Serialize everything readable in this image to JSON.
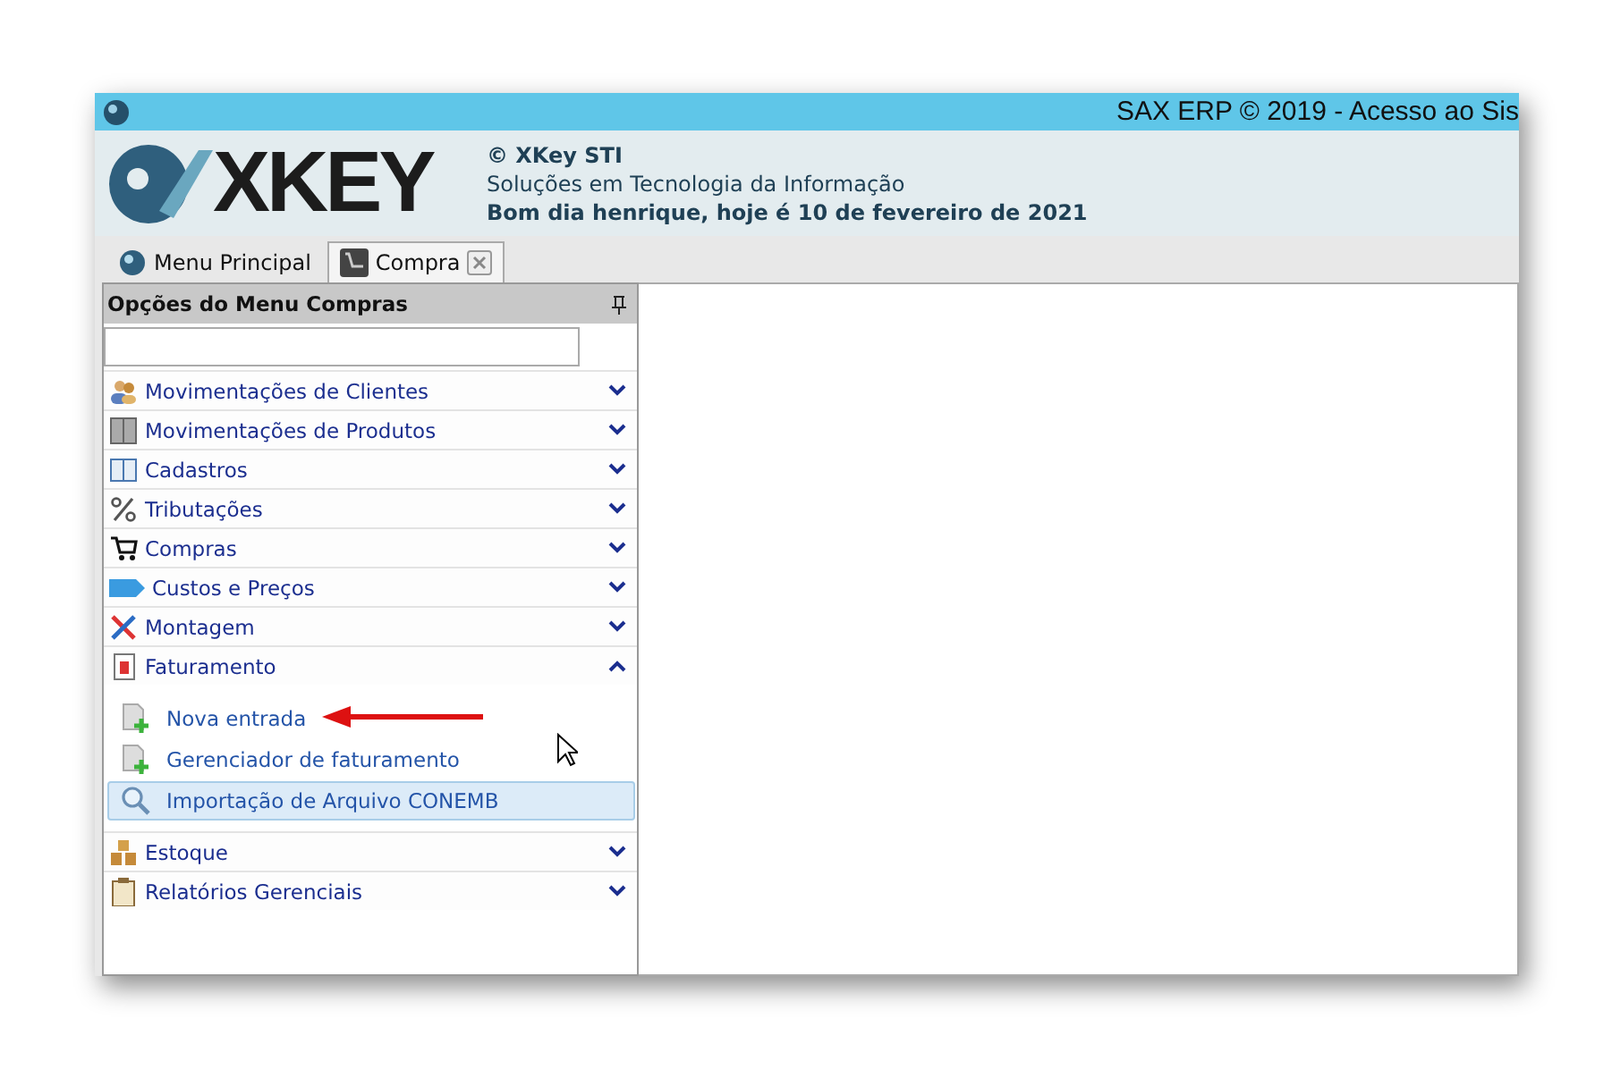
{
  "window": {
    "title": "SAX ERP © 2019 - Acesso ao Sis"
  },
  "header": {
    "logo_text": "XKEY",
    "company": "© XKey STI",
    "tagline": "Soluções em Tecnologia da Informação",
    "greeting": "Bom dia henrique, hoje é 10 de fevereiro de 2021"
  },
  "tabs": [
    {
      "label": "Menu Principal",
      "selected": false,
      "closable": false
    },
    {
      "label": "Compra",
      "selected": true,
      "closable": true
    }
  ],
  "panel": {
    "title": "Opções do Menu Compras",
    "groups": [
      {
        "label": "Movimentações de Clientes",
        "expanded": false
      },
      {
        "label": "Movimentações de Produtos",
        "expanded": false
      },
      {
        "label": "Cadastros",
        "expanded": false
      },
      {
        "label": "Tributações",
        "expanded": false
      },
      {
        "label": "Compras",
        "expanded": false
      },
      {
        "label": "Custos e Preços",
        "expanded": false
      },
      {
        "label": "Montagem",
        "expanded": false
      },
      {
        "label": "Faturamento",
        "expanded": true,
        "items": [
          {
            "label": "Nova entrada",
            "selected": false,
            "kind": "add"
          },
          {
            "label": "Gerenciador de faturamento",
            "selected": false,
            "kind": "add"
          },
          {
            "label": "Importação de Arquivo CONEMB",
            "selected": true,
            "kind": "search"
          }
        ]
      },
      {
        "label": "Estoque",
        "expanded": false
      },
      {
        "label": "Relatórios Gerenciais",
        "expanded": false
      }
    ]
  }
}
